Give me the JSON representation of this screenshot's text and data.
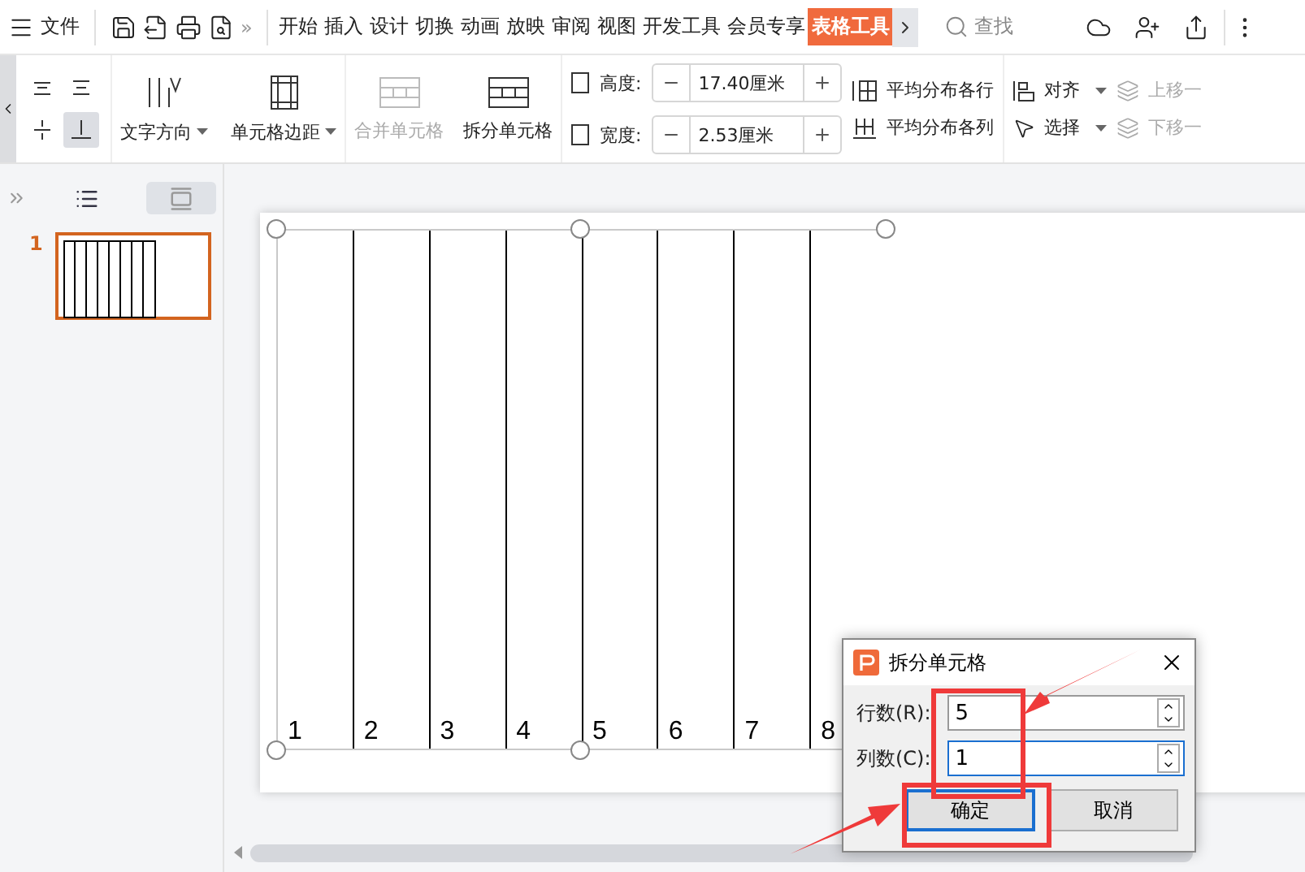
{
  "menu_bar": {
    "file_label": "文件",
    "more_label": "»",
    "tabs": [
      {
        "label": "开始",
        "selected": false
      },
      {
        "label": "插入",
        "selected": false
      },
      {
        "label": "设计",
        "selected": false
      },
      {
        "label": "切换",
        "selected": false
      },
      {
        "label": "动画",
        "selected": false
      },
      {
        "label": "放映",
        "selected": false
      },
      {
        "label": "审阅",
        "selected": false
      },
      {
        "label": "视图",
        "selected": false
      },
      {
        "label": "开发工具",
        "selected": false
      },
      {
        "label": "会员专享",
        "selected": false
      },
      {
        "label": "表格工具",
        "selected": true
      }
    ],
    "search_label": "查找"
  },
  "ribbon": {
    "align_buttons": [
      {
        "selected": false
      },
      {
        "selected": false
      },
      {
        "selected": false
      },
      {
        "selected": true
      }
    ],
    "text_direction": "文字方向",
    "cell_margin": "单元格边距",
    "merge": {
      "label": "合并单元格",
      "disabled": true
    },
    "split": {
      "label": "拆分单元格",
      "disabled": false
    },
    "size_fields": [
      {
        "label": "高度:",
        "value": "17.40厘米"
      },
      {
        "label": "宽度:",
        "value": "2.53厘米"
      }
    ],
    "distribute": [
      "平均分布各行",
      "平均分布各列"
    ],
    "arrange": [
      {
        "label": "对齐",
        "disabled": false
      },
      {
        "label": "选择",
        "disabled": false
      }
    ],
    "layers": [
      {
        "label": "上移一",
        "disabled": true
      },
      {
        "label": "下移一",
        "disabled": true
      }
    ]
  },
  "slide_panel": {
    "views": [
      {
        "kind": "outline",
        "selected": false
      },
      {
        "kind": "slides",
        "selected": true
      }
    ],
    "slides": [
      {
        "number": "1",
        "selected": true
      }
    ]
  },
  "table": {
    "cells": [
      "1",
      "2",
      "3",
      "4",
      "5",
      "6",
      "7",
      "8"
    ]
  },
  "dialog": {
    "title": "拆分单元格",
    "fields": [
      {
        "label": "行数(R):",
        "value": "5",
        "focused": false
      },
      {
        "label": "列数(C):",
        "value": "1",
        "focused": true
      }
    ],
    "buttons": [
      {
        "label": "确定",
        "default": true
      },
      {
        "label": "取消",
        "default": false
      }
    ]
  }
}
